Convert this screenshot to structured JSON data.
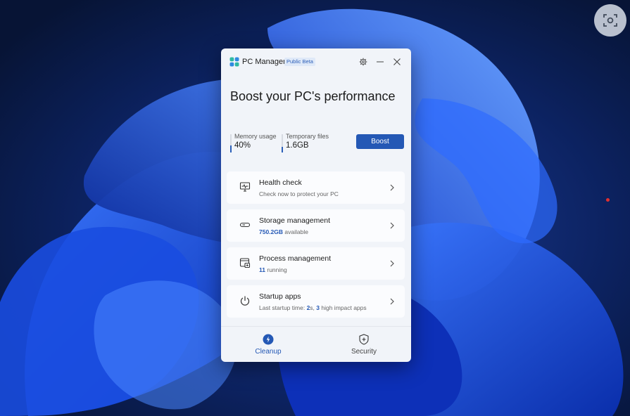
{
  "app": {
    "title": "PC Manager",
    "badge": "Public Beta",
    "headline": "Boost your PC's performance"
  },
  "stats": {
    "memory": {
      "label": "Memory usage",
      "value": "40%",
      "fraction": 0.4
    },
    "temp": {
      "label": "Temporary files",
      "value": "1.6GB",
      "fraction": 0.3
    }
  },
  "boost_label": "Boost",
  "cards": [
    {
      "title": "Health check",
      "sub_pre": "Check now to protect your PC",
      "sub_em": "",
      "sub_post": "",
      "sub_em2": "",
      "sub_post2": "",
      "icon": "monitor-icon"
    },
    {
      "title": "Storage management",
      "sub_pre": "",
      "sub_em": "750.2GB",
      "sub_post": " available",
      "sub_em2": "",
      "sub_post2": "",
      "icon": "drive-icon"
    },
    {
      "title": "Process management",
      "sub_pre": "",
      "sub_em": "11",
      "sub_post": " running",
      "sub_em2": "",
      "sub_post2": "",
      "icon": "process-icon"
    },
    {
      "title": "Startup apps",
      "sub_pre": "Last startup time: ",
      "sub_em": "2",
      "sub_post": "s, ",
      "sub_em2": "3",
      "sub_post2": " high impact apps",
      "icon": "power-icon"
    }
  ],
  "nav": {
    "cleanup": "Cleanup",
    "security": "Security"
  },
  "colors": {
    "accent": "#2458b5",
    "window_bg": "#f1f4f9",
    "card_bg": "#fbfcfe"
  }
}
